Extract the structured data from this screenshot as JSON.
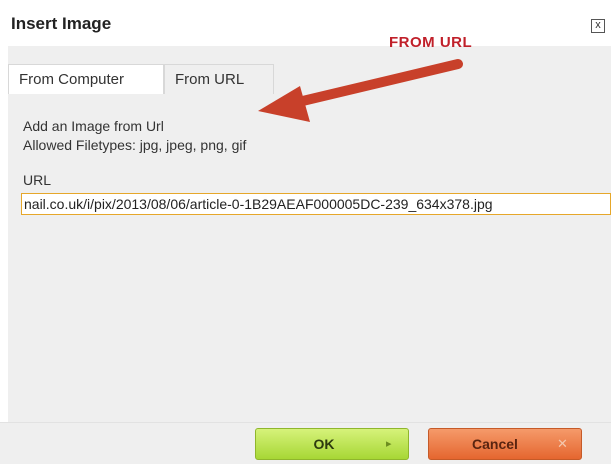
{
  "dialog": {
    "title": "Insert Image",
    "close_label": "x"
  },
  "annotation": {
    "label": "FROM URL",
    "color": "#c0202a"
  },
  "tabs": [
    {
      "label": "From Computer",
      "active": false
    },
    {
      "label": "From URL",
      "active": true
    }
  ],
  "panel": {
    "info_line1": "Add an Image from Url",
    "info_line2": "Allowed Filetypes: jpg, jpeg, png, gif",
    "url_label": "URL",
    "url_value": "nail.co.uk/i/pix/2013/08/06/article-0-1B29AEAF000005DC-239_634x378.jpg"
  },
  "buttons": {
    "ok_label": "OK",
    "ok_icon": "triangle-right-icon",
    "cancel_label": "Cancel",
    "cancel_icon": "x-icon"
  },
  "colors": {
    "ok_button": "#a7d735",
    "cancel_button": "#e5662f",
    "input_border": "#e6a72a"
  }
}
